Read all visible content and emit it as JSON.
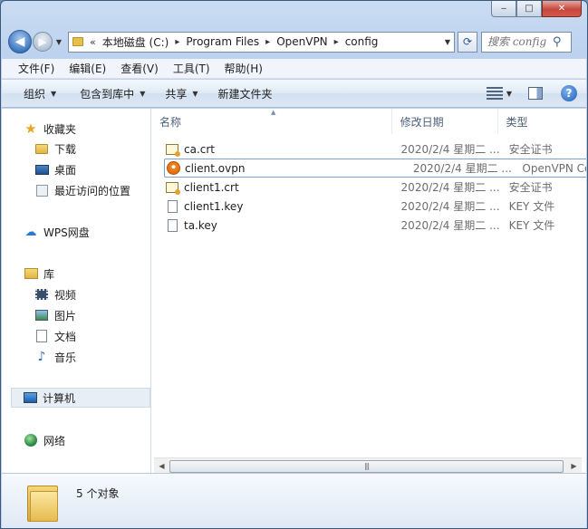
{
  "window": {
    "controls": {
      "minimize": "‒",
      "maximize": "□",
      "close": "✕"
    }
  },
  "navigation": {
    "back": "◀",
    "forward": "▶",
    "history_dropdown": "▼",
    "address_overflow": "«",
    "breadcrumb": [
      "本地磁盘 (C:)",
      "Program Files",
      "OpenVPN",
      "config"
    ],
    "separator": "▸",
    "address_dropdown": "▼",
    "refresh": "⟳"
  },
  "search": {
    "placeholder": "搜索 config",
    "icon": "search-icon"
  },
  "menubar": [
    "文件(F)",
    "编辑(E)",
    "查看(V)",
    "工具(T)",
    "帮助(H)"
  ],
  "commandbar": {
    "organize": "组织",
    "include_in_library": "包含到库中",
    "share": "共享",
    "new_folder": "新建文件夹",
    "help": "?"
  },
  "navpane": {
    "favorites": {
      "label": "收藏夹",
      "items": [
        "下载",
        "桌面",
        "最近访问的位置"
      ]
    },
    "wps": "WPS网盘",
    "libraries": {
      "label": "库",
      "items": [
        "视频",
        "图片",
        "文档",
        "音乐"
      ]
    },
    "computer": "计算机",
    "network": "网络"
  },
  "columns": {
    "name": "名称",
    "date": "修改日期",
    "type": "类型"
  },
  "files": [
    {
      "name": "ca.crt",
      "date": "2020/2/4 星期二 ...",
      "type": "安全证书",
      "icon": "certificate-icon"
    },
    {
      "name": "client.ovpn",
      "date": "2020/2/4 星期二 ...",
      "type": "OpenVPN Co",
      "icon": "openvpn-config-icon"
    },
    {
      "name": "client1.crt",
      "date": "2020/2/4 星期二 ...",
      "type": "安全证书",
      "icon": "certificate-icon"
    },
    {
      "name": "client1.key",
      "date": "2020/2/4 星期二 ...",
      "type": "KEY 文件",
      "icon": "file-icon"
    },
    {
      "name": "ta.key",
      "date": "2020/2/4 星期二 ...",
      "type": "KEY 文件",
      "icon": "file-icon"
    }
  ],
  "scrollbar": {
    "left": "◀",
    "right": "▶",
    "grip": "|||"
  },
  "status": {
    "text": "5 个对象"
  },
  "colors": {
    "selection_border": "#7da2ce",
    "accent": "#1f5cb4"
  }
}
